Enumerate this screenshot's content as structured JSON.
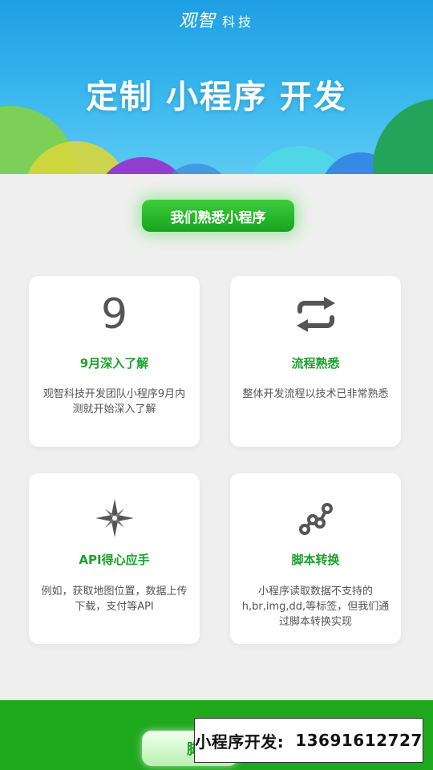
{
  "header": {
    "logo_mark": "观智",
    "logo_text": "科技",
    "hero_title": "定制 小程序 开发"
  },
  "section": {
    "pill_label": "我们熟悉小程序"
  },
  "features": [
    {
      "icon": "nine-icon",
      "icon_glyph": "9",
      "title": "9月深入了解",
      "desc": "观智科技开发团队小程序9月内测就开始深入了解"
    },
    {
      "icon": "swap-arrows-icon",
      "title": "流程熟悉",
      "desc": "整体开发流程以技术已非常熟悉"
    },
    {
      "icon": "compass-star-icon",
      "title": "API得心应手",
      "desc": "例如，获取地图位置，数据上传下载，支付等API"
    },
    {
      "icon": "nodes-graph-icon",
      "title": "脚本转换",
      "desc": "小程序读取数据不支持的h,br,img,dd,等标签，但我们通过脚本转换实现"
    }
  ],
  "footer": {
    "button_label": "脚",
    "contact_label": "小程序开发:",
    "contact_phone": "13691612727"
  },
  "colors": {
    "accent_green": "#1aa12b",
    "banner_blue": "#2ea9ea",
    "footer_green": "#1ea81c"
  }
}
